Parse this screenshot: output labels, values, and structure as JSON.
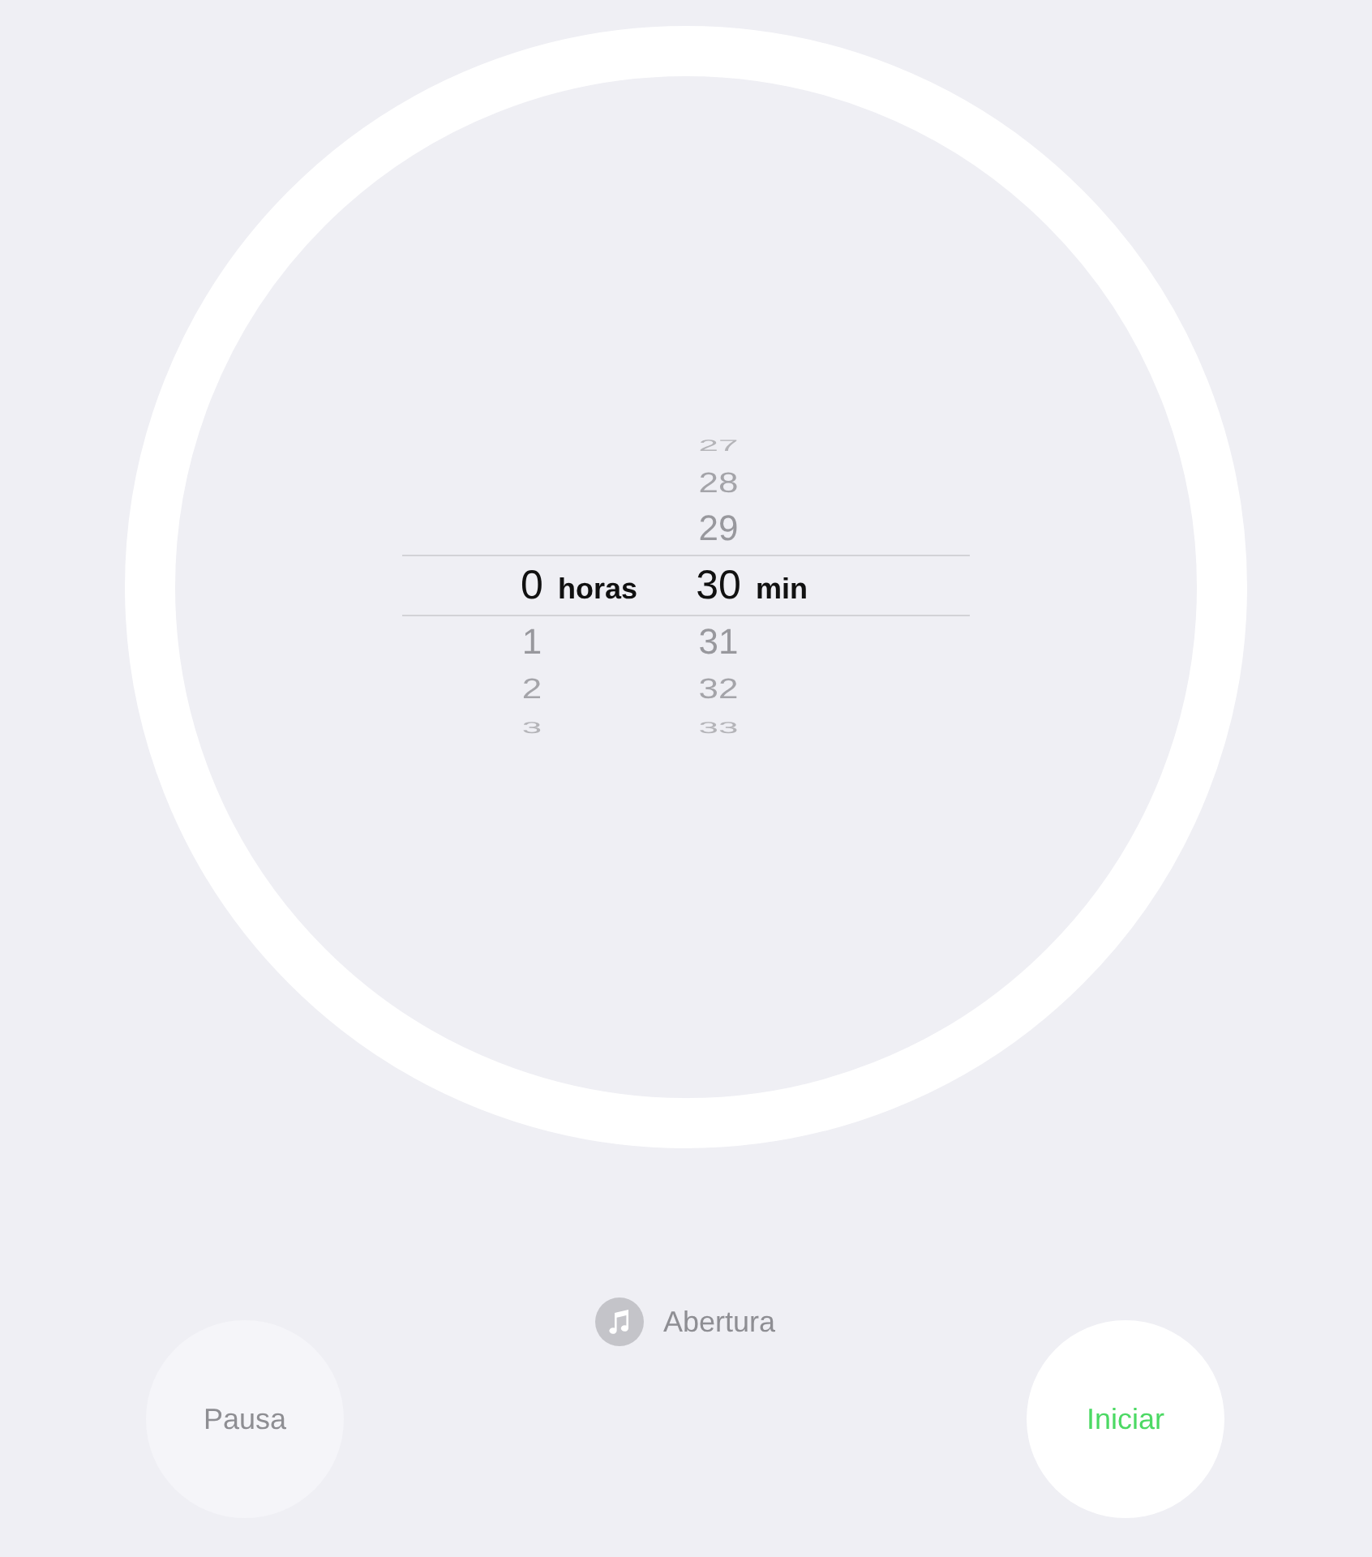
{
  "picker": {
    "columns": [
      {
        "unit": "horas",
        "items": [
          {
            "label": "0",
            "selected": true
          },
          {
            "label": "1",
            "selected": false
          },
          {
            "label": "2",
            "selected": false
          },
          {
            "label": "3",
            "selected": false
          }
        ]
      },
      {
        "unit": "min",
        "items": [
          {
            "label": "27",
            "selected": false
          },
          {
            "label": "28",
            "selected": false
          },
          {
            "label": "29",
            "selected": false
          },
          {
            "label": "30",
            "selected": true
          },
          {
            "label": "31",
            "selected": false
          },
          {
            "label": "32",
            "selected": false
          },
          {
            "label": "33",
            "selected": false
          }
        ]
      }
    ]
  },
  "sound": {
    "label": "Abertura"
  },
  "buttons": [
    {
      "kind": "pause",
      "label": "Pausa",
      "disabled": true
    },
    {
      "kind": "start",
      "label": "Iniciar",
      "disabled": false
    }
  ]
}
